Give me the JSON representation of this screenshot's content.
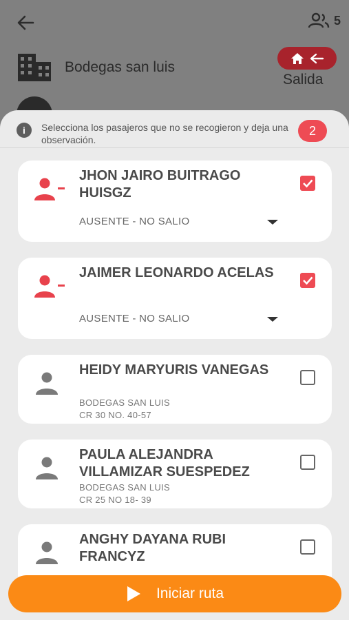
{
  "header": {
    "passenger_count": "5",
    "title": "Bodegas san luis",
    "trip_type": "Salida"
  },
  "sheet": {
    "notice": "Selecciona los pasajeros que no se recogieron y deja una observación.",
    "selected_count": "2"
  },
  "passengers": [
    {
      "name": "JHON JAIRO BUITRAGO HUISGZ",
      "status": "AUSENTE - NO SALIO",
      "checked": true
    },
    {
      "name": "JAIMER LEONARDO ACELAS",
      "status": "AUSENTE - NO SALIO",
      "checked": true
    },
    {
      "name": "HEIDY MARYURIS VANEGAS",
      "place": "BODEGAS SAN LUIS",
      "address": "CR 30 NO. 40-57",
      "checked": false
    },
    {
      "name": "PAULA ALEJANDRA VILLAMIZAR SUESPEDEZ",
      "place": "BODEGAS SAN LUIS",
      "address": "CR 25 NO 18- 39",
      "checked": false
    },
    {
      "name": "ANGHY DAYANA RUBI FRANCYZ",
      "checked": false
    }
  ],
  "actions": {
    "start_label": "Iniciar ruta"
  },
  "colors": {
    "accent_red": "#ee4b54",
    "primary_orange": "#fb8a15",
    "absent_icon": "#e8424c",
    "present_icon": "#7a7a7a"
  },
  "icons": {
    "back": "arrow-left-icon",
    "group": "people-icon",
    "building": "building-icon",
    "home": "home-icon",
    "info": "info-icon",
    "absent": "person-remove-icon",
    "present": "person-icon",
    "check": "checkbox-icon",
    "dropdown": "caret-down-icon",
    "play": "play-icon"
  }
}
